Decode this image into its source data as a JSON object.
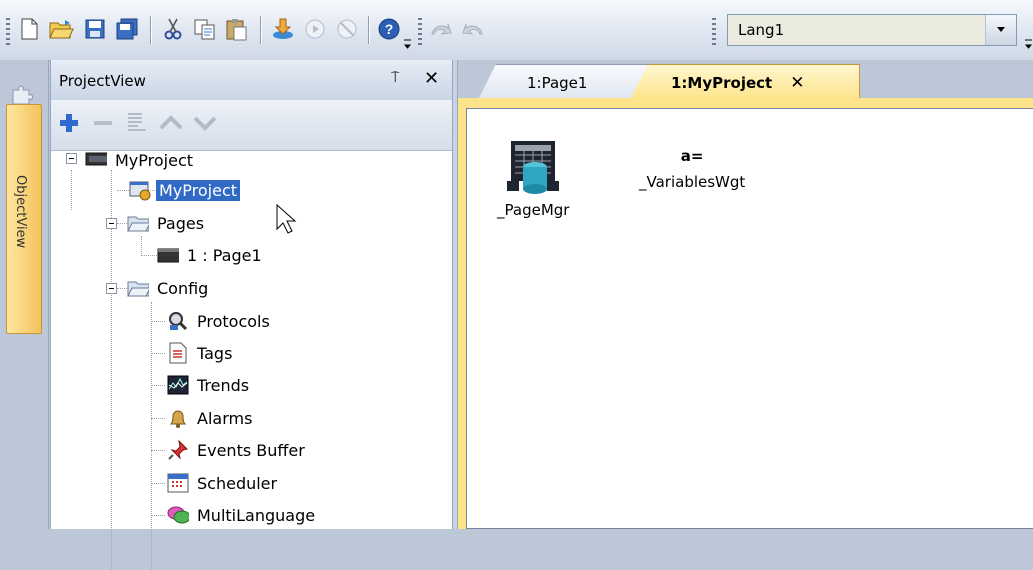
{
  "toolbar": {
    "buttons": [
      "new",
      "open",
      "save",
      "save-all",
      "cut",
      "copy",
      "paste",
      "download",
      "run",
      "stop",
      "help",
      "undo",
      "redo"
    ],
    "language_value": "Lang1"
  },
  "object_view": {
    "tab_label": "ObjectView"
  },
  "project_view": {
    "title": "ProjectView",
    "pin_glyph": "⍑",
    "close_glyph": "✕",
    "tree": {
      "root": "MyProject",
      "project_node": "MyProject",
      "pages": "Pages",
      "page1": "1 : Page1",
      "config": "Config",
      "config_items": [
        "Protocols",
        "Tags",
        "Trends",
        "Alarms",
        "Events Buffer",
        "Scheduler",
        "MultiLanguage"
      ]
    }
  },
  "document": {
    "tabs": [
      {
        "label": "1:Page1",
        "active": false
      },
      {
        "label": "1:MyProject",
        "active": true
      }
    ],
    "close_glyph": "✕",
    "widgets": [
      {
        "label": "_PageMgr",
        "icon": "page-manager-icon"
      },
      {
        "label": "_VariablesWgt",
        "icon_text": "a="
      }
    ]
  },
  "colors": {
    "active_tab": "#fde48a",
    "selection": "#316ac5",
    "panel_bg": "#bcc7d8"
  }
}
